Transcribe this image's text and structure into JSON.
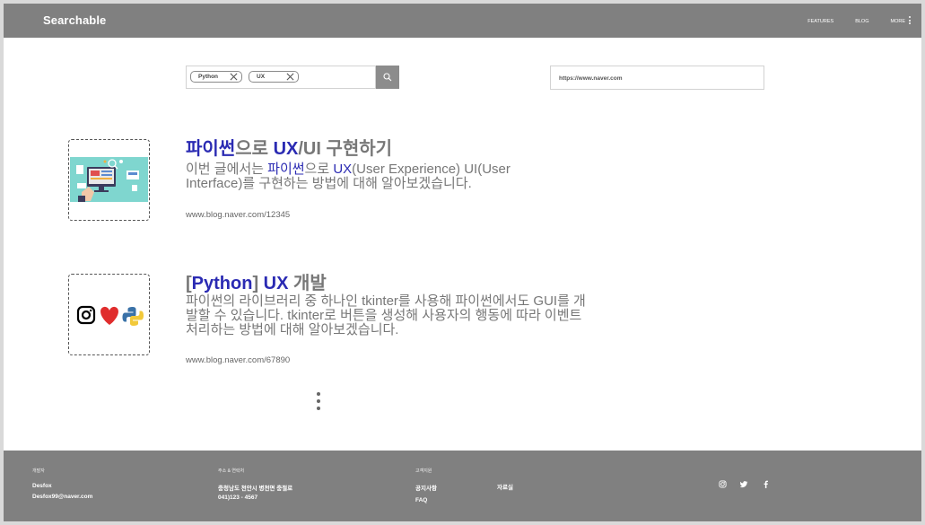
{
  "header": {
    "brand": "Searchable",
    "nav": {
      "features": "FEATURES",
      "blog": "BLOG",
      "more": "MORE"
    }
  },
  "search": {
    "tags": [
      "Python",
      "UX"
    ],
    "url_value": "https://www.naver.com"
  },
  "results": [
    {
      "title_parts": [
        "파이썬",
        "으로 ",
        "UX",
        "/UI 구현하기"
      ],
      "desc_parts": [
        "이번 글에서는 ",
        "파이썬",
        "으로 ",
        "UX",
        "(User Experience) UI(User Interface)를 구현하는 방법에 대해 알아보겠습니다."
      ],
      "url": "www.blog.naver.com/12345"
    },
    {
      "title_parts": [
        "[",
        "Python",
        "] ",
        "UX",
        " 개발"
      ],
      "desc": "파이썬의 라이브러리 중 하나인 tkinter를 사용해 파이썬에서도 GUI를 개발할 수 있습니다. tkinter로 버튼을 생성해 사용자의 행동에 따라 이벤트 처리하는 방법에 대해 알아보겠습니다.",
      "url": "www.blog.naver.com/67890"
    }
  ],
  "footer": {
    "developer": {
      "label": "개발자",
      "name": "Desfox",
      "email": "Desfox99@naver.com"
    },
    "address": {
      "label": "주소 & 연락처",
      "addr": "충청남도 천안시 병천면 충절로",
      "phone": "041)123 - 4567"
    },
    "support": {
      "label": "고객지원",
      "notice": "공지사항",
      "faq": "FAQ",
      "resources": "자료실"
    },
    "social_icons": [
      "instagram-icon",
      "twitter-icon",
      "facebook-icon"
    ]
  },
  "colors": {
    "bar": "#808080",
    "highlight": "#2b2bb3",
    "text": "#777777"
  }
}
